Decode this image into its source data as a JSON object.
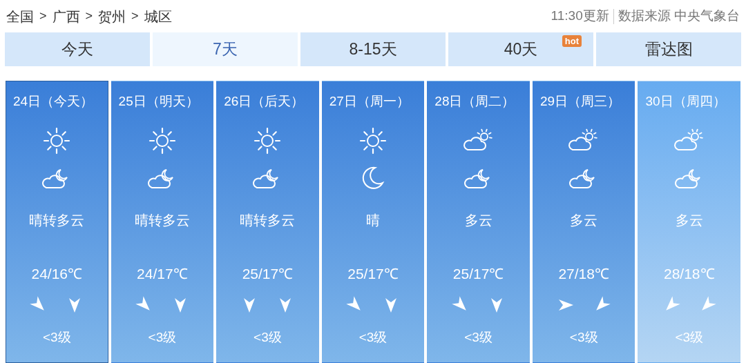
{
  "breadcrumb": [
    "全国",
    ">",
    "广西",
    ">",
    "贺州",
    ">",
    "城区"
  ],
  "update_time": "11:30更新",
  "source": "数据来源 中央气象台",
  "tabs": [
    {
      "label": "今天",
      "selected": false
    },
    {
      "label": "7天",
      "selected": true
    },
    {
      "label": "8-15天",
      "selected": false
    },
    {
      "label": "40天",
      "selected": false,
      "badge": "hot"
    },
    {
      "label": "雷达图",
      "selected": false
    }
  ],
  "days": [
    {
      "date": "24日（今天）",
      "selected": true,
      "dimmed": false,
      "icons": [
        {
          "kind": "sun"
        },
        {
          "kind": "cloud_moon"
        }
      ],
      "weather": "晴转多云",
      "temp": "24/16℃",
      "winds": [
        {
          "kind": "se"
        },
        {
          "kind": "s"
        }
      ],
      "wind_level": "<3级"
    },
    {
      "date": "25日（明天）",
      "selected": false,
      "dimmed": false,
      "icons": [
        {
          "kind": "sun"
        },
        {
          "kind": "cloud_moon"
        }
      ],
      "weather": "晴转多云",
      "temp": "24/17℃",
      "winds": [
        {
          "kind": "se"
        },
        {
          "kind": "s"
        }
      ],
      "wind_level": "<3级"
    },
    {
      "date": "26日（后天）",
      "selected": false,
      "dimmed": false,
      "icons": [
        {
          "kind": "sun"
        },
        {
          "kind": "cloud_moon"
        }
      ],
      "weather": "晴转多云",
      "temp": "25/17℃",
      "winds": [
        {
          "kind": "s"
        },
        {
          "kind": "s"
        }
      ],
      "wind_level": "<3级"
    },
    {
      "date": "27日（周一）",
      "selected": false,
      "dimmed": false,
      "icons": [
        {
          "kind": "sun"
        },
        {
          "kind": "moon"
        }
      ],
      "weather": "晴",
      "temp": "25/17℃",
      "winds": [
        {
          "kind": "se"
        },
        {
          "kind": "s"
        }
      ],
      "wind_level": "<3级"
    },
    {
      "date": "28日（周二）",
      "selected": false,
      "dimmed": false,
      "icons": [
        {
          "kind": "cloud_sun"
        },
        {
          "kind": "cloud_moon"
        }
      ],
      "weather": "多云",
      "temp": "25/17℃",
      "winds": [
        {
          "kind": "se"
        },
        {
          "kind": "s"
        }
      ],
      "wind_level": "<3级"
    },
    {
      "date": "29日（周三）",
      "selected": false,
      "dimmed": false,
      "icons": [
        {
          "kind": "cloud_sun"
        },
        {
          "kind": "cloud_moon"
        }
      ],
      "weather": "多云",
      "temp": "27/18℃",
      "winds": [
        {
          "kind": "e"
        },
        {
          "kind": "sw"
        }
      ],
      "wind_level": "<3级"
    },
    {
      "date": "30日（周四）",
      "selected": false,
      "dimmed": true,
      "icons": [
        {
          "kind": "cloud_sun"
        },
        {
          "kind": "cloud_moon"
        }
      ],
      "weather": "多云",
      "temp": "28/18℃",
      "winds": [
        {
          "kind": "sw"
        },
        {
          "kind": "sw"
        }
      ],
      "wind_level": "<3级"
    }
  ]
}
